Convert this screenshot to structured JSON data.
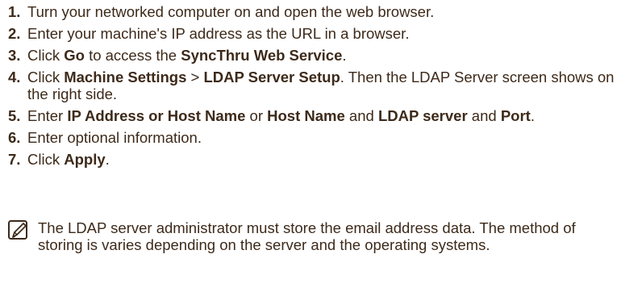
{
  "steps": [
    {
      "number": "1.",
      "parts": [
        {
          "text": "Turn your networked computer on and open the web browser.",
          "bold": false
        }
      ]
    },
    {
      "number": "2.",
      "parts": [
        {
          "text": "Enter your machine's IP address as the URL in a browser.",
          "bold": false
        }
      ]
    },
    {
      "number": "3.",
      "parts": [
        {
          "text": "Click ",
          "bold": false
        },
        {
          "text": "Go",
          "bold": true
        },
        {
          "text": " to access the ",
          "bold": false
        },
        {
          "text": "SyncThru Web Service",
          "bold": true
        },
        {
          "text": ".",
          "bold": false
        }
      ]
    },
    {
      "number": "4.",
      "parts": [
        {
          "text": "Click ",
          "bold": false
        },
        {
          "text": "Machine Settings",
          "bold": true
        },
        {
          "text": " > ",
          "bold": false
        },
        {
          "text": "LDAP Server Setup",
          "bold": true
        },
        {
          "text": ". Then the LDAP Server screen shows on the right side.",
          "bold": false
        }
      ]
    },
    {
      "number": "5.",
      "parts": [
        {
          "text": "Enter ",
          "bold": false
        },
        {
          "text": "IP Address or Host Name",
          "bold": true
        },
        {
          "text": " or ",
          "bold": false
        },
        {
          "text": "Host Name",
          "bold": true
        },
        {
          "text": " and ",
          "bold": false
        },
        {
          "text": "LDAP server",
          "bold": true
        },
        {
          "text": " and ",
          "bold": false
        },
        {
          "text": "Port",
          "bold": true
        },
        {
          "text": ".",
          "bold": false
        }
      ]
    },
    {
      "number": "6.",
      "parts": [
        {
          "text": "Enter optional information.",
          "bold": false
        }
      ]
    },
    {
      "number": "7.",
      "parts": [
        {
          "text": "Click ",
          "bold": false
        },
        {
          "text": "Apply",
          "bold": true
        },
        {
          "text": ".",
          "bold": false
        }
      ]
    }
  ],
  "note": {
    "icon": "note-pencil-icon",
    "text": "The LDAP server administrator must store the email address data. The method of storing is varies depending on the server and the operating systems."
  },
  "colors": {
    "text": "#3d2a1a",
    "icon": "#3d2a1a"
  }
}
